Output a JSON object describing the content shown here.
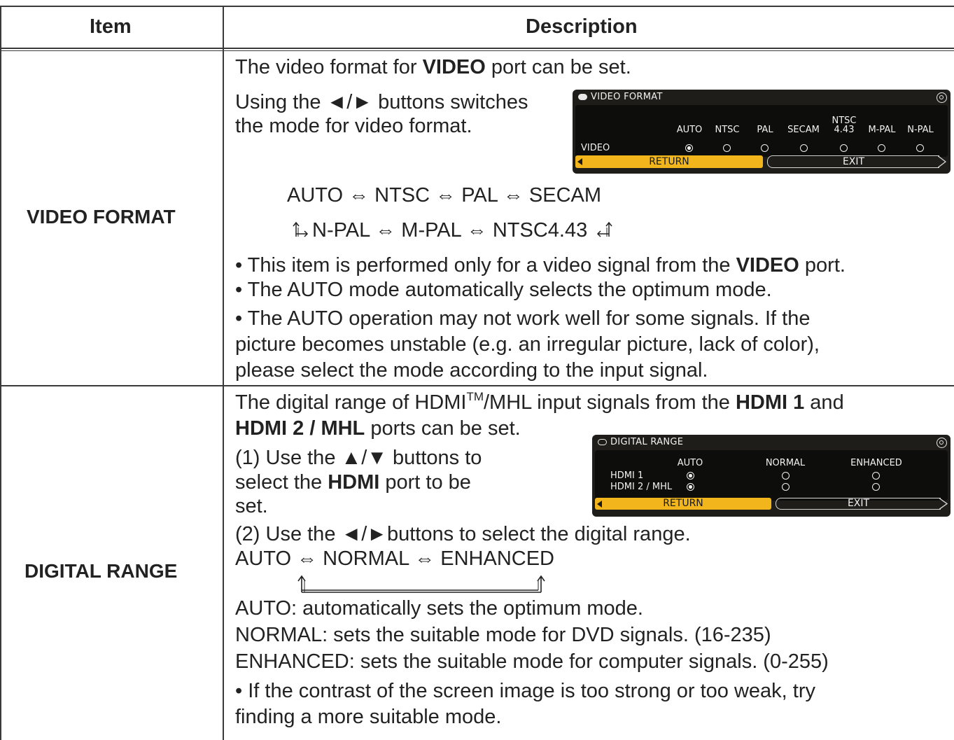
{
  "header": {
    "item": "Item",
    "description": "Description"
  },
  "video_format": {
    "name": "VIDEO FORMAT",
    "line1_pre": "The video format for ",
    "line1_bold": "VIDEO",
    "line1_post": " port can be set.",
    "line2": "Using the ◄/► buttons switches",
    "line3": "the mode for video format.",
    "cycle1": "AUTO  ⇔  NTSC  ⇔  PAL  ⇔  SECAM",
    "cycle2_pre": "⇳",
    "cycle2": "N-PAL ⇔ M-PAL ⇔ NTSC4.43",
    "bullet1_pre": "• This item is performed only for a video signal from the ",
    "bullet1_bold": "VIDEO",
    "bullet1_post": " port.",
    "bullet2": "• The AUTO mode automatically selects the optimum mode.",
    "bullet3a": "• The AUTO operation may not work well for some signals. If the",
    "bullet3b": "picture becomes unstable (e.g. an irregular picture, lack of color),",
    "bullet3c": "please select the mode according to the input signal.",
    "osd": {
      "title": "VIDEO FORMAT",
      "cols": [
        "AUTO",
        "NTSC",
        "PAL",
        "SECAM",
        "NTSC",
        "M-PAL",
        "N-PAL"
      ],
      "col5_sub": "4.43",
      "row_label": "VIDEO",
      "selected": "AUTO",
      "return_label": "RETURN",
      "exit_label": "EXIT"
    }
  },
  "digital_range": {
    "name": "DIGITAL RANGE",
    "line1_pre": "The digital range of HDMI",
    "line1_tm": "TM",
    "line1_mid": "/MHL input signals from the ",
    "line1_bold": "HDMI 1",
    "line1_post": " and",
    "line2_bold": "HDMI 2 / MHL",
    "line2_post": " ports can be set.",
    "line3": "(1) Use the ▲/▼ buttons to",
    "line4_pre": "select the ",
    "line4_bold": "HDMI",
    "line4_post": " port to be",
    "line5": "set.",
    "line6": "(2) Use the ◄/►buttons to select the digital range.",
    "cycle": "AUTO ⇔ NORMAL ⇔ ENHANCED",
    "auto_desc": "AUTO: automatically sets the optimum mode.",
    "normal_desc": "NORMAL: sets the suitable mode for DVD signals. (16-235)",
    "enhanced_desc": "ENHANCED: sets the suitable mode for computer signals. (0-255)",
    "bullet_a": "• If the contrast of the screen image is too strong or too weak, try",
    "bullet_b": "finding a more suitable mode.",
    "osd": {
      "title": "DIGITAL RANGE",
      "cols": [
        "AUTO",
        "NORMAL",
        "ENHANCED"
      ],
      "rows": [
        "HDMI 1",
        "HDMI 2 / MHL"
      ],
      "selected": "AUTO",
      "return_label": "RETURN",
      "exit_label": "EXIT"
    }
  }
}
